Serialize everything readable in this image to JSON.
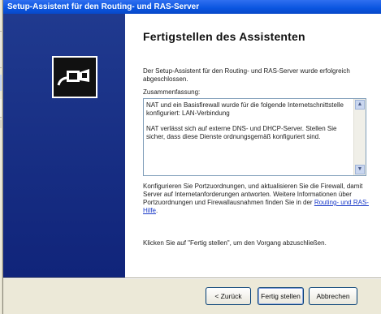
{
  "window": {
    "title": "Setup-Assistent für den Routing- und RAS-Server"
  },
  "wizard": {
    "heading": "Fertigstellen des Assistenten",
    "intro": "Der Setup-Assistent für den Routing- und RAS-Server wurde erfolgreich abgeschlossen.",
    "summary_label": "Zusammenfassung:",
    "summary_p1": "NAT und ein Basisfirewall wurde für die folgende Internetschnittstelle konfiguriert: LAN-Verbindung",
    "summary_p2": "NAT verlässt sich auf externe DNS- und DHCP-Server. Stellen Sie sicher, dass diese Dienste ordnungsgemäß konfiguriert sind.",
    "info_text": "Konfigurieren Sie Portzuordnungen, und aktualisieren Sie die Firewall, damit Server auf Internetanforderungen antworten. Weitere Informationen über Portzuordnungen und Firewallausnahmen finden Sie in der ",
    "info_link": "Routing- und RAS-Hilfe",
    "info_end": ".",
    "finish_hint": "Klicken Sie auf \"Fertig stellen\", um den Vorgang abzuschließen."
  },
  "buttons": {
    "back": "< Zurück",
    "finish": "Fertig stellen",
    "cancel": "Abbrechen"
  },
  "icons": {
    "scroll_up": "scroll-up-arrow",
    "scroll_down": "scroll-down-arrow",
    "wizard": "routing-cable-icon"
  },
  "colors": {
    "titlebar": "#0a55e0",
    "sidepanel": "#10247a",
    "link": "#1a3ac8"
  }
}
